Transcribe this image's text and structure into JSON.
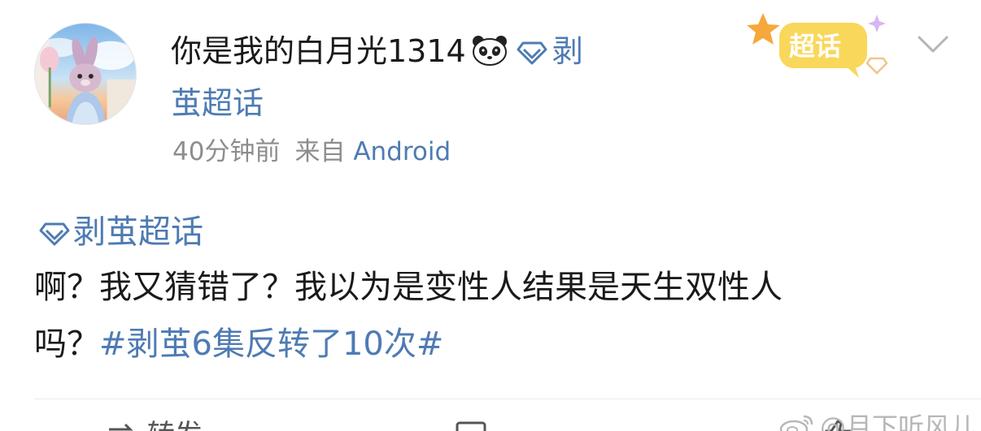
{
  "post": {
    "author": {
      "name": "你是我的白月光1314",
      "emoji": "panda-emoji",
      "avatar": "avatar-rabbit-plush-image"
    },
    "supertopic_tag": "剥茧超话",
    "timestamp": "40分钟前",
    "source_prefix": "来自",
    "source": "Android",
    "badge_label": "超话",
    "topic_link": "剥茧超话",
    "body_line1": "啊？我又猜错了？我以为是变性人结果是天生双性人",
    "body_line2_prefix": "吗？",
    "hashtag": "#剥茧6集反转了10次#"
  },
  "actions": {
    "repost_label": "转发"
  },
  "watermark": {
    "text": "@月下听风儿"
  },
  "colors": {
    "link_blue": "#4e7bb3",
    "meta_gray": "#8d8d8d",
    "badge_yellow": "#f9d75a",
    "badge_orange": "#f6a83a"
  },
  "icons": [
    "diamond-icon",
    "chevron-down-icon",
    "supertopic-badge-icon",
    "weibo-logo-icon",
    "repost-icon",
    "comment-icon",
    "like-icon"
  ]
}
